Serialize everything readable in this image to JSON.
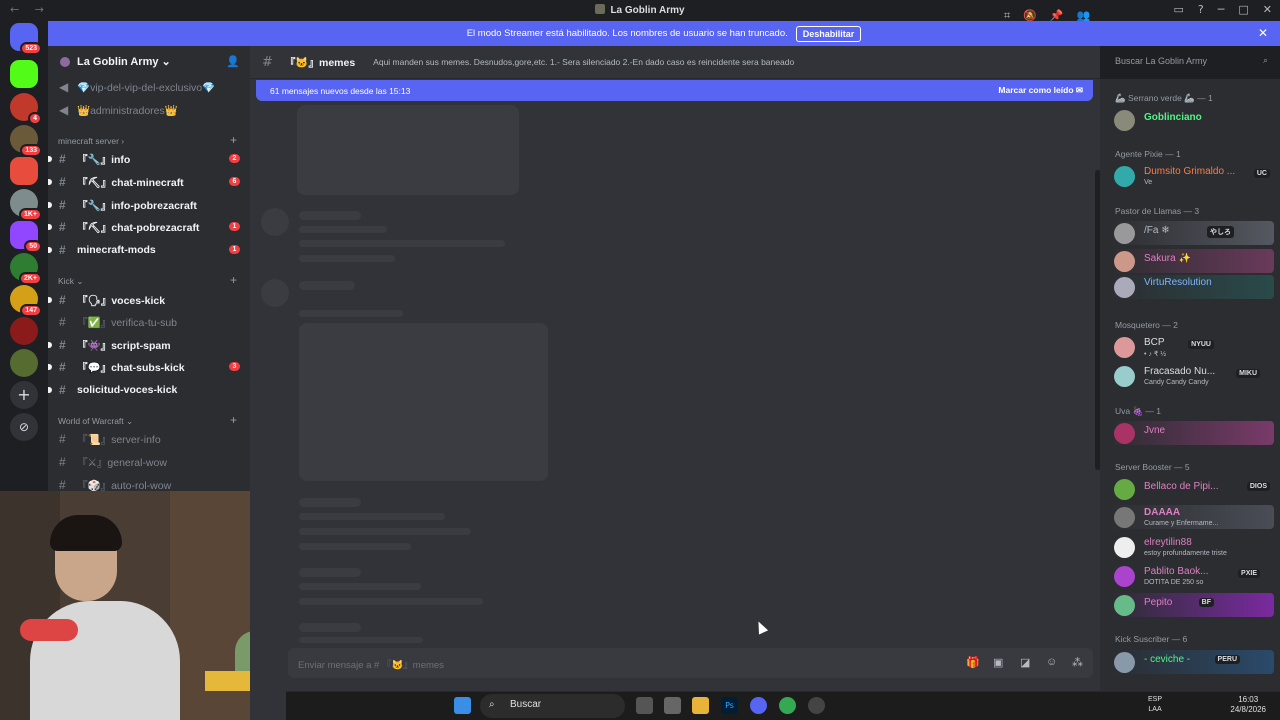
{
  "window": {
    "title": "La Goblin Army",
    "nav": "← →"
  },
  "banner": {
    "text": "El modo Streamer está habilitado. Los nombres de usuario se han truncado.",
    "button": "Deshabilitar"
  },
  "servers": {
    "badges": [
      "523",
      "4",
      "133",
      "1K+",
      "50",
      "2K+",
      "147"
    ]
  },
  "guild": {
    "name": "La Goblin Army ⌄"
  },
  "channels": {
    "top": [
      {
        "label": "💎vip-del-vip-del-exclusivo💎"
      },
      {
        "label": "👑administradores👑"
      }
    ],
    "cat_minecraft": "minecraft server ›",
    "minecraft": [
      {
        "label": "『🔧』info",
        "count": "2"
      },
      {
        "label": "『⛏』chat-minecraft",
        "count": "6"
      },
      {
        "label": "『🔧』info-pobrezacraft",
        "count": ""
      },
      {
        "label": "『⛏』chat-pobrezacraft",
        "count": "1"
      },
      {
        "label": "minecraft-mods",
        "count": "1"
      }
    ],
    "cat_kick": "Kick ⌄",
    "kick": [
      {
        "label": "『🗣』voces-kick",
        "count": ""
      },
      {
        "label": "『✅』verifica-tu-sub",
        "count": ""
      },
      {
        "label": "『👾』script-spam",
        "count": ""
      },
      {
        "label": "『💬』chat-subs-kick",
        "count": "3"
      },
      {
        "label": "solicitud-voces-kick",
        "count": ""
      }
    ],
    "cat_wow": "World of Warcraft ⌄",
    "wow": [
      {
        "label": "『📜』server-info"
      },
      {
        "label": "『⚔』general-wow"
      },
      {
        "label": "『🎲』auto-rol-wow"
      }
    ]
  },
  "header": {
    "channel": "『🐱』memes",
    "topic": "Aqui manden sus memes. Desnudos,gore,etc. 1.- Sera silenciado 2.-En dado caso es reincidente sera baneado"
  },
  "search": {
    "placeholder": "Buscar La Goblin Army"
  },
  "newmsg": {
    "text": "61 mensajes nuevos desde las 15:13",
    "mark": "Marcar como leído"
  },
  "input": {
    "placeholder": "Enviar mensaje a # 『🐱』memes"
  },
  "members": {
    "groups": [
      "🦾 Serrano verde 🦾 — 1",
      "Agente Pixie — 1",
      "Pastor de Llamas — 3",
      "Mosquetero — 2",
      "Uva 🍇 — 1",
      "Server Booster — 5",
      "Kick Suscriber — 6"
    ],
    "list": [
      {
        "name": "Goblinciano",
        "status": "",
        "tag": "",
        "color": "#57f287"
      },
      {
        "name": "Dumsito Grimaldo ...",
        "status": "Ve",
        "tag": "UC",
        "color": "#ff7a45"
      },
      {
        "name": "/Fa ❄",
        "status": "",
        "tag": "やしろ",
        "color": "#b5bac1"
      },
      {
        "name": "Sakura ✨",
        "status": "",
        "tag": "",
        "color": "#e07fc3"
      },
      {
        "name": "VirtuResolution",
        "status": "",
        "tag": "",
        "color": "#7fb4ff"
      },
      {
        "name": "BCP",
        "status": "• ♪ ₹ ½",
        "tag": "NYUU",
        "color": "#dbdee1"
      },
      {
        "name": "Fracasado Nu...",
        "status": "Candy Candy Candy",
        "tag": "MIKU",
        "color": "#dbdee1"
      },
      {
        "name": "Jvne",
        "status": "",
        "tag": "",
        "color": "#e07fc3"
      },
      {
        "name": "Bellaco de Pipi...",
        "status": "",
        "tag": "DIOS",
        "color": "#e07fc3"
      },
      {
        "name": "DAAAA",
        "status": "Curame y Enfermame...",
        "tag": "",
        "color": "#e07fc3"
      },
      {
        "name": "elreytilin88",
        "status": "estoy profundamente triste",
        "tag": "",
        "color": "#e07fc3"
      },
      {
        "name": "Pablito Baok...",
        "status": "DOTITA DE 250 so",
        "tag": "PXIE",
        "color": "#e07fc3"
      },
      {
        "name": "Pepito",
        "status": "",
        "tag": "BF",
        "color": "#e07fc3"
      },
      {
        "name": "- ceviche -",
        "status": "",
        "tag": "PERU",
        "color": "#57f287"
      }
    ]
  },
  "taskbar": {
    "search": "Buscar",
    "lang": "ESP",
    "lang2": "LAA",
    "time": "16:03",
    "date": "24/8/2026"
  },
  "colors": {
    "accent": "#5865f2",
    "danger": "#f23f43"
  }
}
